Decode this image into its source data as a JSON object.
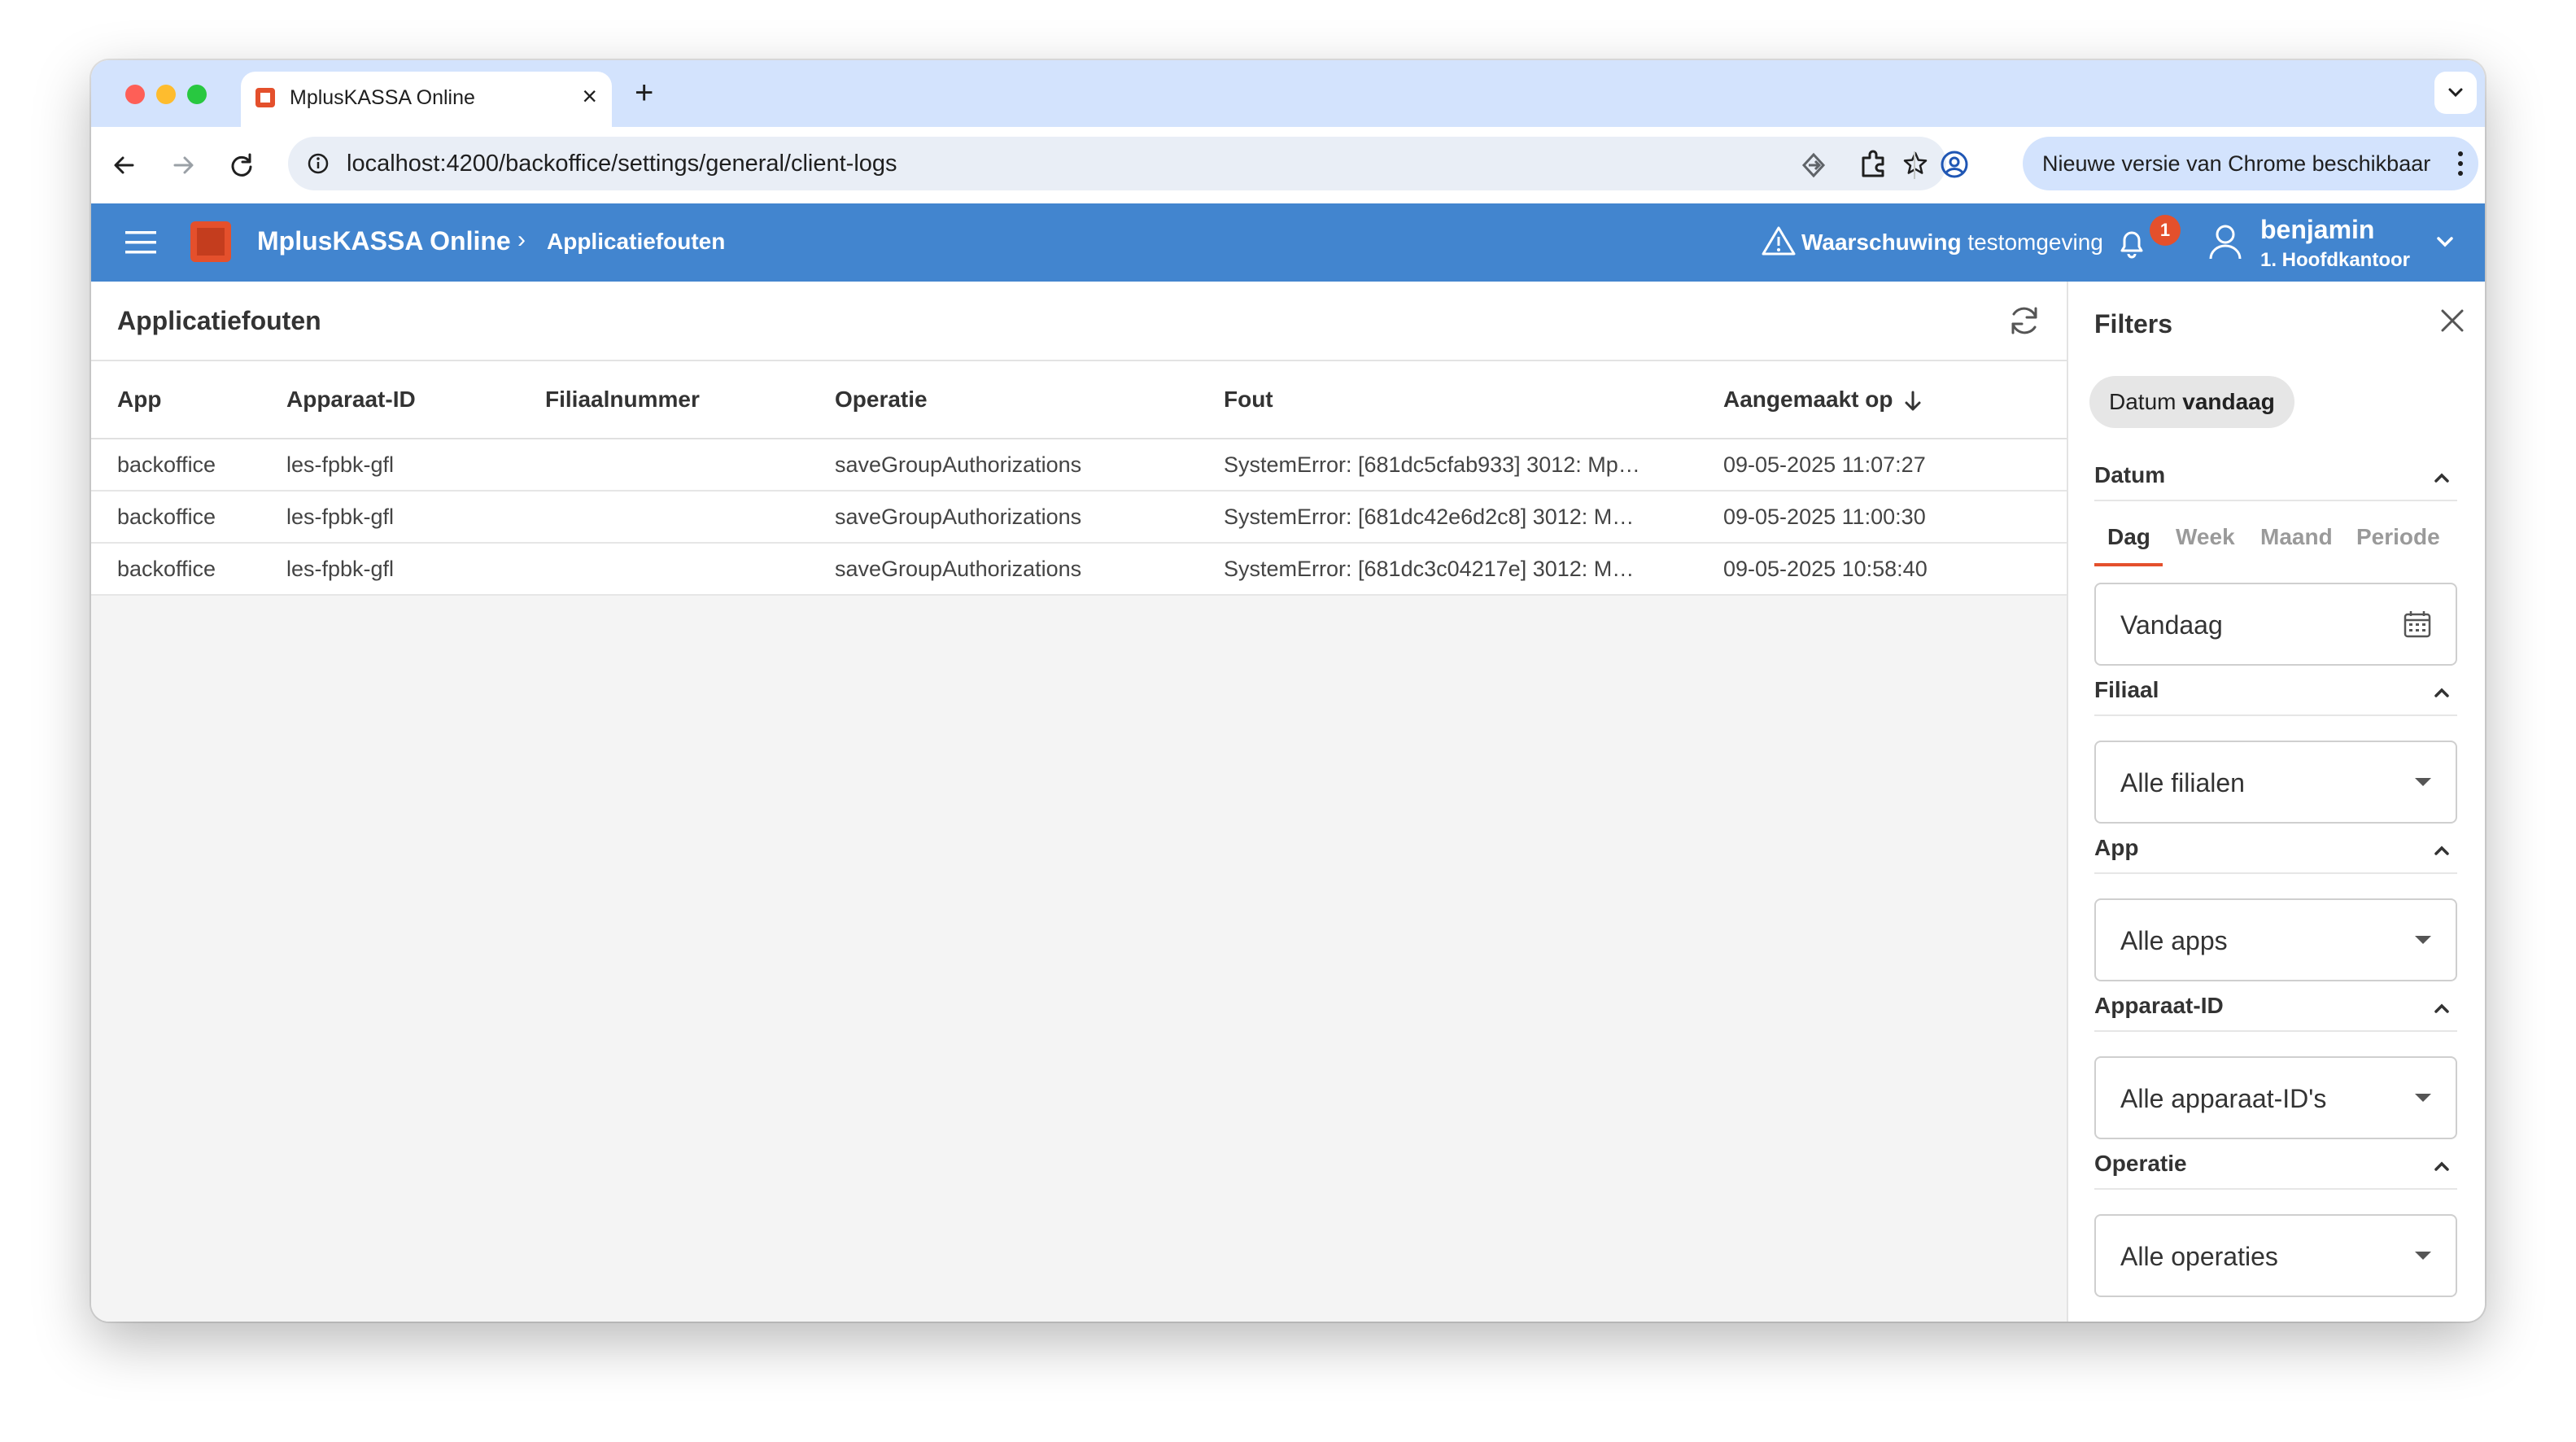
{
  "browser": {
    "tab_title": "MplusKASSA Online",
    "url": "localhost:4200/backoffice/settings/general/client-logs",
    "update_label": "Nieuwe versie van Chrome beschikbaar"
  },
  "app": {
    "brand": "MplusKASSA Online",
    "breadcrumb": "Applicatiefouten",
    "warning_bold": "Waarschuwing",
    "warning_text": "testomgeving",
    "notification_count": "1",
    "user_name": "benjamin",
    "user_branch": "1. Hoofdkantoor"
  },
  "main": {
    "title": "Applicatiefouten",
    "columns": [
      "App",
      "Apparaat-ID",
      "Filiaalnummer",
      "Operatie",
      "Fout",
      "Aangemaakt op"
    ],
    "rows": [
      {
        "app": "backoffice",
        "device": "les-fpbk-gfl",
        "branch": "",
        "operation": "saveGroupAuthorizations",
        "error": "SystemError: [681dc5cfab933] 3012: Mp…",
        "created": "09-05-2025 11:07:27"
      },
      {
        "app": "backoffice",
        "device": "les-fpbk-gfl",
        "branch": "",
        "operation": "saveGroupAuthorizations",
        "error": "SystemError: [681dc42e6d2c8] 3012: M…",
        "created": "09-05-2025 11:00:30"
      },
      {
        "app": "backoffice",
        "device": "les-fpbk-gfl",
        "branch": "",
        "operation": "saveGroupAuthorizations",
        "error": "SystemError: [681dc3c04217e] 3012: M…",
        "created": "09-05-2025 10:58:40"
      }
    ]
  },
  "filters": {
    "title": "Filters",
    "chip_prefix": "Datum",
    "chip_value": "vandaag",
    "date_section": "Datum",
    "date_tabs": [
      "Dag",
      "Week",
      "Maand",
      "Periode"
    ],
    "date_value": "Vandaag",
    "branch_section": "Filiaal",
    "branch_value": "Alle filialen",
    "app_section": "App",
    "app_value": "Alle apps",
    "device_section": "Apparaat-ID",
    "device_value": "Alle apparaat-ID's",
    "operation_section": "Operatie",
    "operation_value": "Alle operaties"
  },
  "colors": {
    "app_bar": "#4285cf",
    "accent": "#e4502c",
    "chrome_tab_strip": "#d3e3fd"
  }
}
